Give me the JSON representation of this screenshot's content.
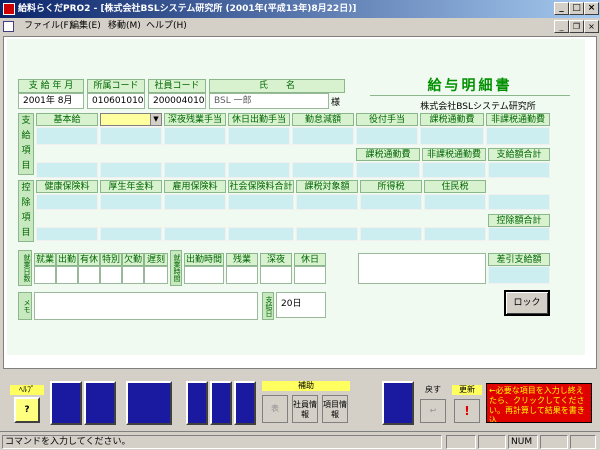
{
  "window": {
    "title": "給料らくだPRO2 - [株式会社BSLシステム研究所 (2001年(平成13年)8月22日)]"
  },
  "menu": {
    "items": [
      "ファイル(F)",
      "編集(E)",
      "移動(M)",
      "ヘルプ(H)"
    ]
  },
  "header": {
    "pay_period_label": "支 給 年 月",
    "dept_code_label": "所属コード",
    "emp_code_label": "社員コード",
    "name_label": "氏　　名",
    "pay_period_value": "2001年 8月",
    "dept_code_value": "0106010106",
    "emp_code_value": "2000040101",
    "name_value": "BSL 一郎",
    "honorific": "様",
    "slip_title": "給与明細書",
    "company": "株式会社BSLシステム研究所"
  },
  "payment": {
    "side_label": [
      "支",
      "給",
      "項",
      "目"
    ],
    "row1": [
      "基本給",
      "",
      "深夜残業手当",
      "休日出勤手当",
      "勤怠減額",
      "役付手当",
      "課税通勤費",
      "非課税通勤費"
    ],
    "row3": [
      "課税通勤費",
      "非課税通勤費",
      "支給額合計"
    ]
  },
  "deduction": {
    "side_label": [
      "控",
      "除",
      "項",
      "目"
    ],
    "row1": [
      "健康保険料",
      "厚生年金料",
      "雇用保険料",
      "社会保険料合計",
      "課税対象額",
      "所得税",
      "住民税"
    ],
    "total_label": "控除額合計"
  },
  "attendance": {
    "side_label": "就業日数",
    "cols": [
      "就業",
      "出勤",
      "有休",
      "特別",
      "欠勤",
      "遅刻"
    ],
    "hours_side": "就業時間",
    "hours_cols": [
      "出勤時間",
      "残業",
      "深夜",
      "休日"
    ],
    "net_pay_label": "差引支給額"
  },
  "memo": {
    "label": "メモ",
    "date_label": "支給日",
    "date_value": "20日"
  },
  "lock_button": "ロック",
  "toolbar": {
    "help_label": "ﾍﾙﾌﾟ",
    "help_key": "?",
    "assist_label": "補助",
    "assist_buttons": [
      "表",
      "社員情報",
      "項目情報"
    ],
    "undo_label": "戻す",
    "undo_icon": "↩",
    "update_label": "更新",
    "update_icon": "!",
    "message": "←必要な項目を入力し終えたら、クリックしてください。再計算して結果を書き込"
  },
  "status": {
    "text": "コマンドを入力してください。",
    "num": "NUM"
  },
  "colors": {
    "form_bg": "#f0faf0",
    "label_bg": "#d8f2d0",
    "field": "#cdeef0",
    "title_green": "#009000",
    "toolbar_blue": "#1a1aa0",
    "alert_red": "#e00000"
  }
}
